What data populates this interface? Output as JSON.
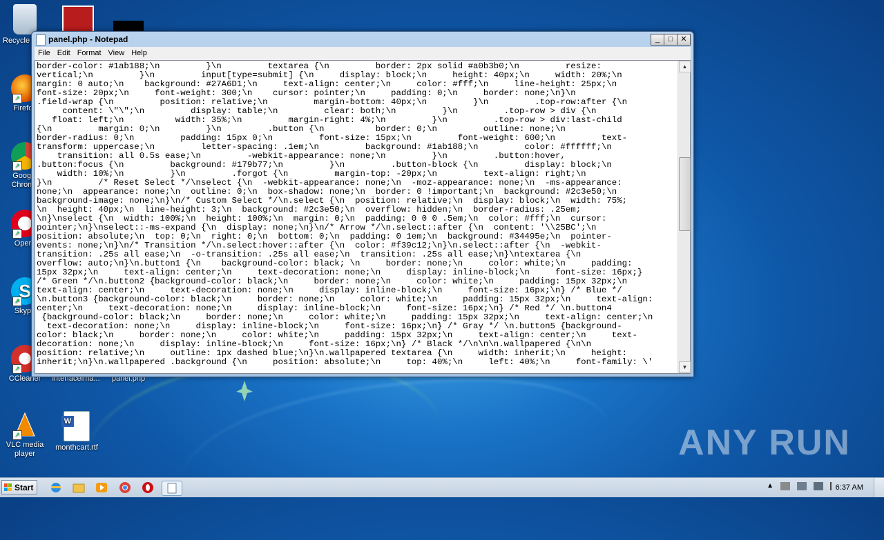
{
  "desktop": {
    "icons": [
      {
        "label": "Recycle Bin"
      },
      {
        "label": "Firefox"
      },
      {
        "label": "Google Chrome"
      },
      {
        "label": "Opera"
      },
      {
        "label": "Skype"
      },
      {
        "label": "CCleaner"
      },
      {
        "label": "interfaceima..."
      },
      {
        "label": "panel.php"
      },
      {
        "label": "VLC media player"
      },
      {
        "label": "monthcart.rtf"
      }
    ],
    "watermark": "ANY RUN"
  },
  "window": {
    "title": "panel.php - Notepad",
    "menu": [
      "File",
      "Edit",
      "Format",
      "View",
      "Help"
    ],
    "content": "border-color: #1ab188;\\n         }\\n         textarea {\\n         border: 2px solid #a0b3b0;\\n         resize:\nvertical;\\n         }\\n         input[type=submit] {\\n     display: block;\\n     height: 40px;\\n     width: 20%;\\n\nmargin: 0 auto;\\n    background: #27A6D1;\\n     text-align: center;\\n     color: #fff;\\n     line-height: 25px;\\n\nfont-size: 20px;\\n     font-weight: 300;\\n    cursor: pointer;\\n     padding: 0;\\n     border: none;\\n}\\n\n.field-wrap {\\n         position: relative;\\n         margin-bottom: 40px;\\n         }\\n         .top-row:after {\\n\n     content: \\\"\\\";\\n         display: table;\\n         clear: both;\\n         }\\n         .top-row > div {\\n\n   float: left;\\n          width: 35%;\\n         margin-right: 4%;\\n         }\\n         .top-row > div:last-child\n{\\n         margin: 0;\\n         }\\n         .button {\\n          border: 0;\\n         outline: none;\\n\nborder-radius: 0;\\n         padding: 15px 0;\\n         font-size: 15px;\\n         font-weight: 600;\\n         text-\ntransform: uppercase;\\n         letter-spacing: .1em;\\n         background: #1ab188;\\n         color: #ffffff;\\n\n    transition: all 0.5s ease;\\n         -webkit-appearance: none;\\n         }\\n         .button:hover,\n.button:focus {\\n         background: #179b77;\\n         }\\n         .button-block {\\n         display: block;\\n\n    width: 10%;\\n         }\\n         .forgot {\\n         margin-top: -20px;\\n         text-align: right;\\n\n}\\n         /* Reset Select */\\nselect {\\n  -webkit-appearance: none;\\n  -moz-appearance: none;\\n  -ms-appearance:\nnone;\\n  appearance: none;\\n  outline: 0;\\n  box-shadow: none;\\n  border: 0 !important;\\n  background: #2c3e50;\\n\nbackground-image: none;\\n}\\n/* Custom Select */\\n.select {\\n  position: relative;\\n  display: block;\\n  width: 75%;\n\\n  height: 40px;\\n  line-height: 3;\\n  background: #2c3e50;\\n  overflow: hidden;\\n  border-radius: .25em;\n\\n}\\nselect {\\n  width: 100%;\\n  height: 100%;\\n  margin: 0;\\n  padding: 0 0 0 .5em;\\n  color: #fff;\\n  cursor:\npointer;\\n}\\nselect::-ms-expand {\\n  display: none;\\n}\\n/* Arrow */\\n.select::after {\\n  content: '\\\\25BC';\\n\nposition: absolute;\\n  top: 0;\\n  right: 0;\\n  bottom: 0;\\n  padding: 0 1em;\\n  background: #34495e;\\n  pointer-\nevents: none;\\n}\\n/* Transition */\\n.select:hover::after {\\n  color: #f39c12;\\n}\\n.select::after {\\n  -webkit-\ntransition: .25s all ease;\\n  -o-transition: .25s all ease;\\n  transition: .25s all ease;\\n}\\ntextarea {\\n\noverflow: auto;\\n}\\n.button1 {\\n    background-color: black; \\n     border: none;\\n     color: white;\\n     padding:\n15px 32px;\\n     text-align: center;\\n     text-decoration: none;\\n     display: inline-block;\\n     font-size: 16px;}\n/* Green */\\n.button2 {background-color: black;\\n     border: none;\\n     color: white;\\n     padding: 15px 32px;\\n\ntext-align: center;\\n     text-decoration: none;\\n     display: inline-block;\\n     font-size: 16px;\\n} /* Blue */\n\\n.button3 {background-color: black;\\n     border: none;\\n     color: white;\\n     padding: 15px 32px;\\n     text-align:\ncenter;\\n     text-decoration: none;\\n     display: inline-block;\\n     font-size: 16px;\\n} /* Red */ \\n.button4\n {background-color: black;\\n     border: none;\\n     color: white;\\n     padding: 15px 32px;\\n     text-align: center;\\n\n  text-decoration: none;\\n     display: inline-block;\\n     font-size: 16px;\\n} /* Gray */ \\n.button5 {background-\ncolor: black;\\n     border: none;\\n     color: white;\\n     padding: 15px 32px;\\n     text-align: center;\\n     text-\ndecoration: none;\\n     display: inline-block;\\n     font-size: 16px;\\n} /* Black */\\n\\n\\n.wallpapered {\\n\\n\nposition: relative;\\n     outline: 1px dashed blue;\\n}\\n.wallpapered textarea {\\n     width: inherit;\\n     height:\ninherit;\\n}\\n.wallpapered .background {\\n     position: absolute;\\n     top: 40%;\\n     left: 40%;\\n     font-family: \\'"
  },
  "taskbar": {
    "start_label": "Start",
    "clock": "6:37 AM"
  }
}
